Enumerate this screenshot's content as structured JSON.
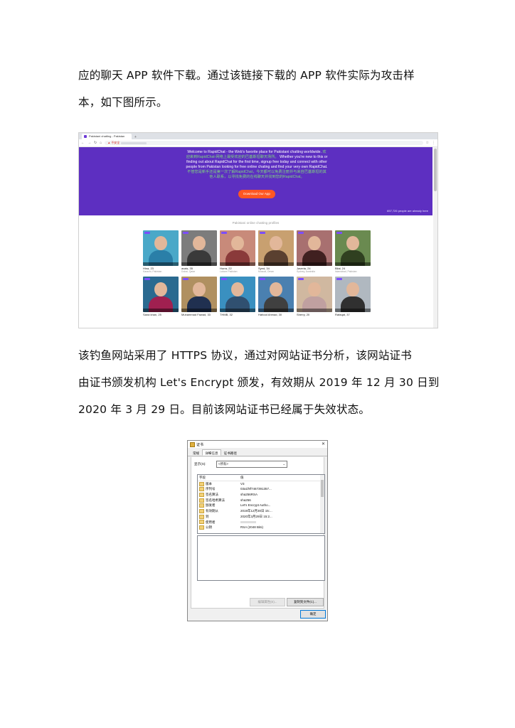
{
  "text": {
    "para1_line1": "应的聊天 APP 软件下载。通过该链接下载的 APP 软件实际为攻击样",
    "para1_line2": "本，如下图所示。",
    "para2_line1": "该钓鱼网站采用了 HTTPS 协议，通过对网站证书分析，该网站证书",
    "para2_line2": "由证书颁发机构 Let's Encrypt  颁发，有效期从 2019 年 12 月 30 日到",
    "para2_line3": "2020 年 3 月 29 日。目前该网站证书已经属于失效状态。"
  },
  "browser": {
    "tab_title": "Pakistani chatting - Pakistan",
    "address_warning": "▲ 不安全",
    "hero_text_en1": "Welcome to RapidChat - the Web's favorite place for Pakistani chatting worldwide.",
    "hero_text_cn1": "欢迎来到RapidChat-网络上最受欢迎的巴基斯坦聊天场所。",
    "hero_text_en2": "Whether you're new to this or finding out about RapidChat for the first time, signup free today and connect with other people from Pakistan looking for free online chating and find your very own RapidChat.",
    "hero_text_cn2": "不管您是新手还是第一次了解RapidChat，今天都可以免费注册并与来自巴基斯坦的其他人联系，以寻找免费的在线聊天并找到您的RapidChat。",
    "cta": "Download Our App",
    "online_count": "657,726 people are already here",
    "profiles_title": "Pakistani online chatting profiles",
    "profiles": [
      {
        "name": "Hina, 23",
        "loc": "Karachi, Pakistan",
        "bg": "#4aa8c8",
        "body": "#2a7fa8"
      },
      {
        "name": "avais, 35",
        "loc": "Dubai, Qatar",
        "bg": "#7c7c7c",
        "body": "#3a3a3a"
      },
      {
        "name": "Hurra, 22",
        "loc": "Lahore Pakistan",
        "bg": "#c88a7a",
        "body": "#8a3a3a"
      },
      {
        "name": "Syed, 34",
        "loc": "Muscat, Oman",
        "bg": "#c8a070",
        "body": "#5a4030"
      },
      {
        "name": "Javeria, 24",
        "loc": "Sydney, Australia",
        "bg": "#a87070",
        "body": "#402020"
      },
      {
        "name": "Bilal, 24",
        "loc": "Islamabad, Pakistan",
        "bg": "#6a8a50",
        "body": "#304020"
      },
      {
        "name": "Sana khan, 25",
        "loc": "",
        "bg": "#2a6a90",
        "body": "#a02050"
      },
      {
        "name": "Muhammad Fawad, 33",
        "loc": "",
        "bg": "#b09060",
        "body": "#203050"
      },
      {
        "name": "THMB, 32",
        "loc": "",
        "bg": "#3a90c0",
        "body": "#305070"
      },
      {
        "name": "Hafood Ahmad, 30",
        "loc": "",
        "bg": "#4a80b0",
        "body": "#404040"
      },
      {
        "name": "Sherry, 20",
        "loc": "",
        "bg": "#d0b8a0",
        "body": "#c0a0a0"
      },
      {
        "name": "Rafaqat, 37",
        "loc": "",
        "bg": "#b0b8c0",
        "body": "#303030"
      }
    ]
  },
  "cert": {
    "title": "证书",
    "tabs": [
      "常规",
      "详细信息",
      "证书路径"
    ],
    "show_label": "显示(S):",
    "show_value": "<所有>",
    "col_field": "字段",
    "col_value": "值",
    "rows": [
      {
        "field": "版本",
        "value": "V3"
      },
      {
        "field": "序列号",
        "value": "03a1f9f7467391357..."
      },
      {
        "field": "签名算法",
        "value": "sha256RSA"
      },
      {
        "field": "签名哈希算法",
        "value": "sha256"
      },
      {
        "field": "颁发者",
        "value": "Let's Encrypt Autho..."
      },
      {
        "field": "有效期从",
        "value": "2019年12月30日 15:..."
      },
      {
        "field": "到",
        "value": "2020年3月29日 15:2..."
      },
      {
        "field": "使用者",
        "value": ""
      },
      {
        "field": "公钥",
        "value": "RSA (2048 Bits)"
      }
    ],
    "edit_button": "编辑属性(E)...",
    "copy_button": "复制到文件(C)...",
    "ok_button": "确定"
  }
}
